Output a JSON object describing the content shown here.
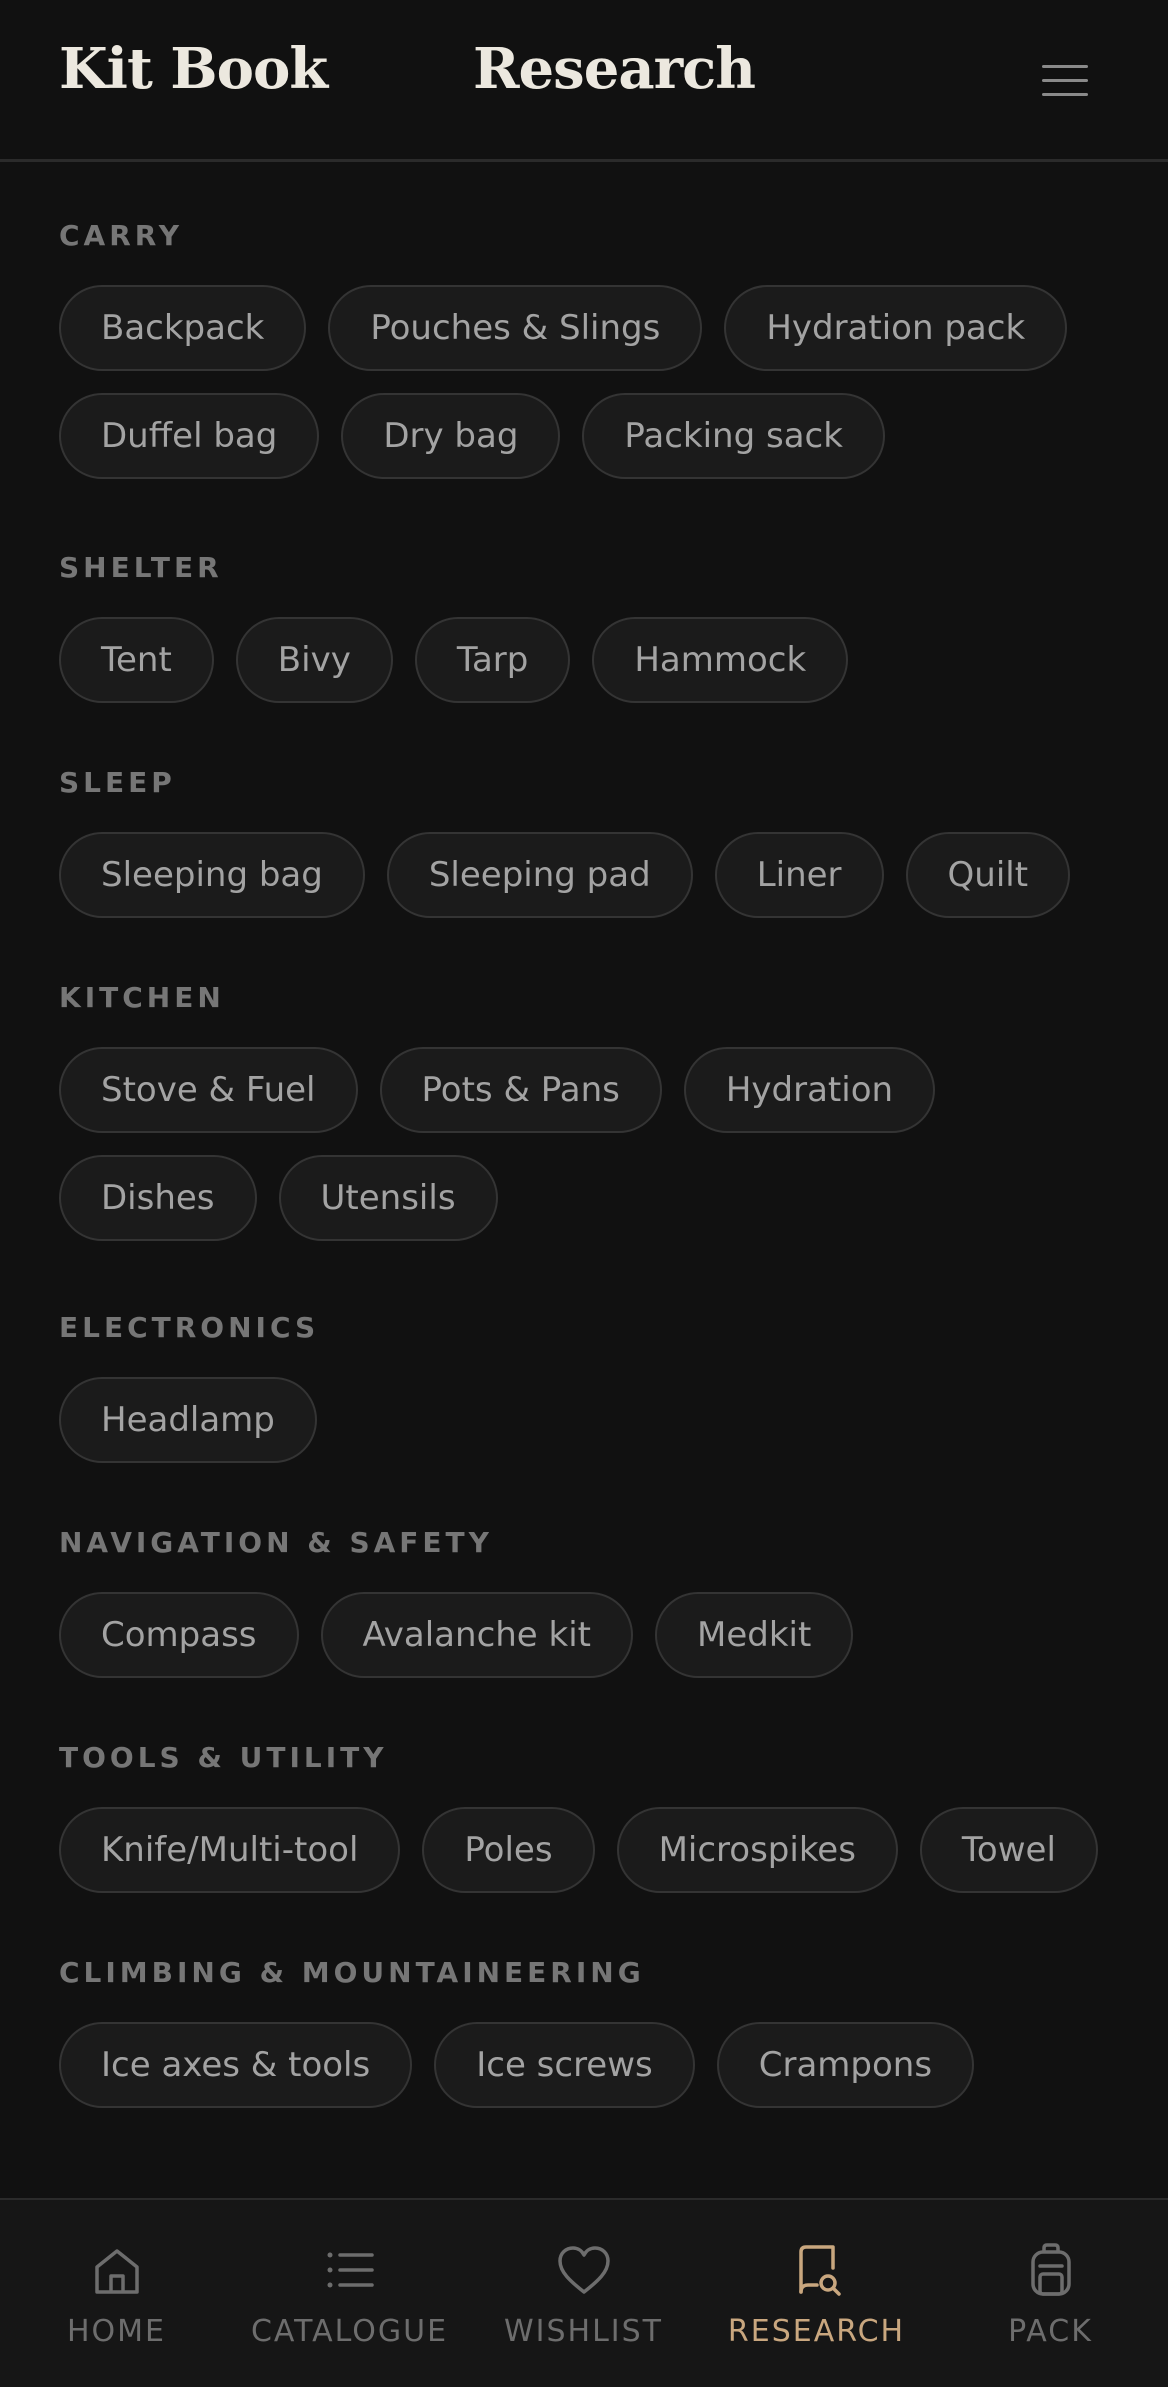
{
  "header": {
    "brand": "Kit Book",
    "title": "Research"
  },
  "sections": [
    {
      "title": "CARRY",
      "items": [
        "Backpack",
        "Pouches & Slings",
        "Hydration pack",
        "Duffel bag",
        "Dry bag",
        "Packing sack"
      ]
    },
    {
      "title": "SHELTER",
      "items": [
        "Tent",
        "Bivy",
        "Tarp",
        "Hammock"
      ]
    },
    {
      "title": "SLEEP",
      "items": [
        "Sleeping bag",
        "Sleeping pad",
        "Liner",
        "Quilt"
      ]
    },
    {
      "title": "KITCHEN",
      "items": [
        "Stove & Fuel",
        "Pots & Pans",
        "Hydration",
        "Dishes",
        "Utensils"
      ]
    },
    {
      "title": "ELECTRONICS",
      "items": [
        "Headlamp"
      ]
    },
    {
      "title": "NAVIGATION & SAFETY",
      "items": [
        "Compass",
        "Avalanche kit",
        "Medkit"
      ]
    },
    {
      "title": "TOOLS & UTILITY",
      "items": [
        "Knife/Multi-tool",
        "Poles",
        "Microspikes",
        "Towel"
      ]
    },
    {
      "title": "CLIMBING & MOUNTAINEERING",
      "items": [
        "Ice axes & tools",
        "Ice screws",
        "Crampons"
      ]
    }
  ],
  "tabbar": {
    "active": "research",
    "tabs": [
      {
        "id": "home",
        "label": "HOME",
        "icon": "home-icon"
      },
      {
        "id": "catalogue",
        "label": "CATALOGUE",
        "icon": "list-icon"
      },
      {
        "id": "wishlist",
        "label": "WISHLIST",
        "icon": "heart-icon"
      },
      {
        "id": "research",
        "label": "RESEARCH",
        "icon": "book-search-icon"
      },
      {
        "id": "pack",
        "label": "PACK",
        "icon": "backpack-icon"
      }
    ]
  },
  "colors": {
    "background": "#111111",
    "accent": "#c9a77f",
    "text": "#ece8df",
    "muted": "#767676"
  }
}
